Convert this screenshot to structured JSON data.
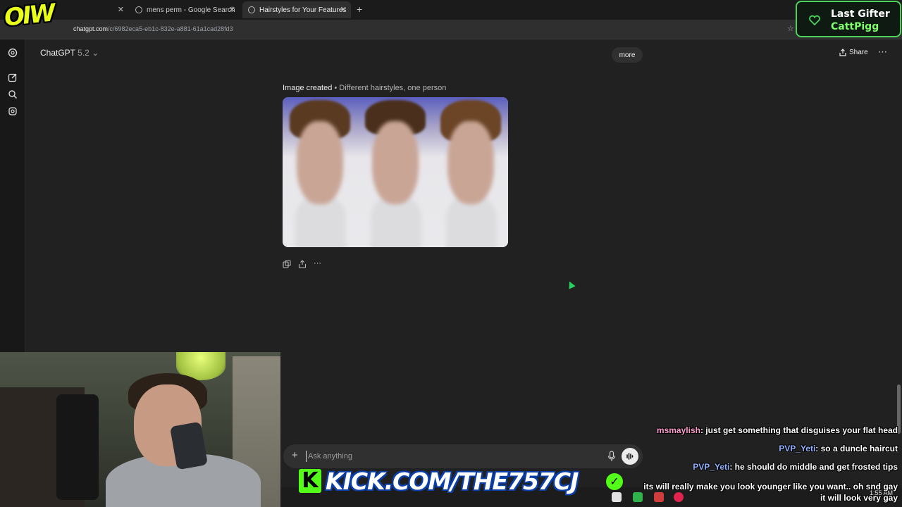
{
  "browser": {
    "tabs": [
      {
        "title": ""
      },
      {
        "title": "mens perm - Google Search"
      },
      {
        "title": "Hairstyles for Your Features"
      }
    ],
    "url_host": "chatgpt.com",
    "url_path": "/c/6982eca5-eb1c-832e-a881-61a1cad28fd3"
  },
  "header": {
    "model_name": "ChatGPT",
    "model_version": "5.2",
    "more_label": "more",
    "share_label": "Share"
  },
  "message": {
    "caption_strong": "Image created",
    "caption_rest": " • Different hairstyles, one person"
  },
  "composer": {
    "placeholder": "Ask anything"
  },
  "overlay": {
    "logo_text": "OIW",
    "gifter_title": "Last Gifter",
    "gifter_name": "CattPigg",
    "kick_letter": "K",
    "kick_url": "KICK.COM/THE757CJ",
    "chat": [
      {
        "user": "msmaylish",
        "text": ": just get something that disguises your flat head",
        "color": "#ff9ccf"
      },
      {
        "user": "PVP_Yeti",
        "text": ": so a duncle haircut",
        "color": "#8fb4ff"
      },
      {
        "user": "PVP_Yeti",
        "text": ": he should do middle and get frosted tips",
        "color": "#8fb4ff"
      },
      {
        "user": "",
        "text": "its will really make you look younger like you want.. oh snd gay",
        "color": "#ffffff"
      },
      {
        "user": "",
        "text": "it will look very gay",
        "color": "#ffffff"
      }
    ]
  },
  "taskbar": {
    "clock": "1:55 AM"
  },
  "colors": {
    "page_bg": "#212121",
    "kick_green": "#53fc18",
    "gifter_border": "#4bd35c"
  }
}
